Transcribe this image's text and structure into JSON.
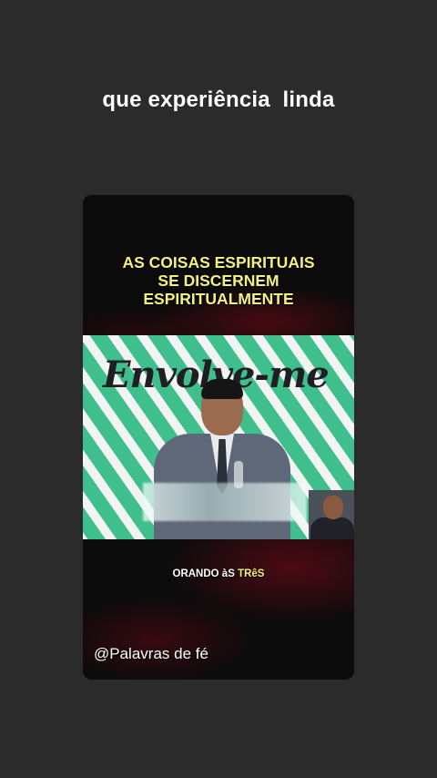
{
  "caption": "que experiência  linda",
  "card": {
    "headline_lines": [
      "AS COISAS ESPIRITUAIS",
      "SE DISCERNEM",
      "ESPIRITUALMENTE"
    ],
    "video_logo_text": "Envolve-me",
    "bottom_label_white": "ORANDO àS ",
    "bottom_label_accent": "TRêS",
    "handle": "@Palavras de fé"
  },
  "colors": {
    "page_background": "#2b2b2b",
    "headline": "#f4f27a",
    "accent": "#f4f27a",
    "video_green": "#3fbf8c"
  }
}
